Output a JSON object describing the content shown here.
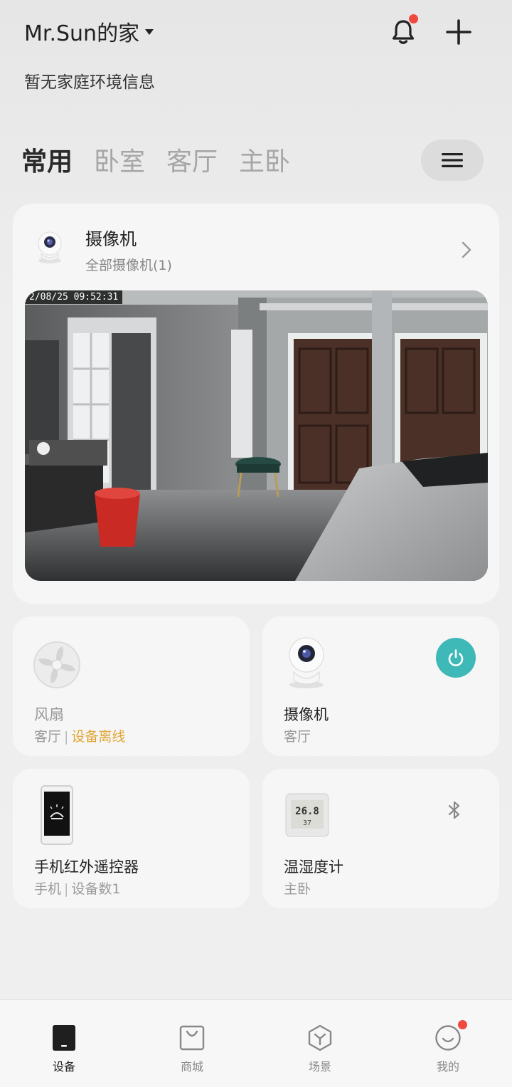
{
  "header": {
    "home_name": "Mr.Sun的家",
    "env_info": "暂无家庭环境信息"
  },
  "tabs": [
    {
      "label": "常用",
      "active": true
    },
    {
      "label": "卧室",
      "active": false
    },
    {
      "label": "客厅",
      "active": false
    },
    {
      "label": "主卧",
      "active": false
    }
  ],
  "camera_card": {
    "title": "摄像机",
    "subtitle": "全部摄像机(1)",
    "timestamp": "2/08/25  09:52:31"
  },
  "devices": [
    {
      "name": "风扇",
      "room": "客厅",
      "status": "设备离线",
      "icon": "fan-icon"
    },
    {
      "name": "摄像机",
      "room": "客厅",
      "icon": "camera-icon",
      "control": "power-icon"
    },
    {
      "name": "手机红外遥控器",
      "room": "手机",
      "status": "设备数1",
      "icon": "phone-remote-icon"
    },
    {
      "name": "温湿度计",
      "room": "主卧",
      "icon": "thermometer-icon",
      "control": "bluetooth-icon",
      "display_temp": "26.8",
      "display_hum": "37"
    }
  ],
  "nav": [
    {
      "label": "设备",
      "icon": "device-icon",
      "active": true
    },
    {
      "label": "商城",
      "icon": "shop-icon",
      "active": false
    },
    {
      "label": "场景",
      "icon": "scene-icon",
      "active": false
    },
    {
      "label": "我的",
      "icon": "profile-icon",
      "active": false,
      "badge": true
    }
  ],
  "colors": {
    "accent_teal": "#3fb8b8",
    "warning": "#e0a430",
    "badge_red": "#f04a3f"
  }
}
